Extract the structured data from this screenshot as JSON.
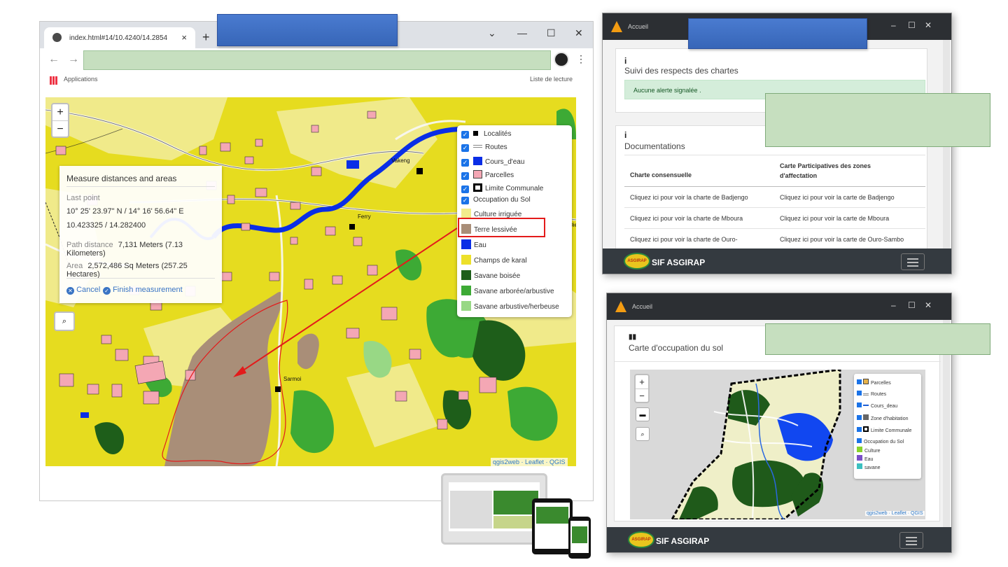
{
  "browser": {
    "tab_title": "index.html#14/10.4240/14.2854",
    "tab_close": "×",
    "new_tab": "+",
    "minimize": "⌄",
    "min2": "—",
    "max": "☐",
    "close": "✕",
    "back": "←",
    "forward": "→",
    "bookmarks_apps": "Applications",
    "bookmarks_list": "Liste de lecture"
  },
  "map": {
    "zoom_in": "+",
    "zoom_out": "−",
    "measure": {
      "title": "Measure distances and areas",
      "last_point_label": "Last point",
      "coords_dms": "10° 25' 23.97\" N / 14° 16' 56.64\" E",
      "coords_dec": "10.423325 / 14.282400",
      "path_label": "Path distance",
      "path_value": "7,131 Meters (7.13 Kilometers)",
      "area_label": "Area",
      "area_value": "2,572,486 Sq Meters (257.25 Hectares)",
      "cancel": "Cancel",
      "finish": "Finish measurement"
    },
    "legend": {
      "layers": [
        {
          "label": "Localités",
          "color": "#000000"
        },
        {
          "label": "Routes",
          "color": "#999999"
        },
        {
          "label": "Cours_d'eau",
          "color": "#0a2ee6"
        },
        {
          "label": "Parcelles",
          "color": "#f4a7b4"
        },
        {
          "label": "Limite Communale",
          "color": "#000000"
        },
        {
          "label": "Occupation du Sol",
          "color": ""
        }
      ],
      "classes": [
        {
          "label": "Culture irriguée",
          "color": "#f2ec8c"
        },
        {
          "label": "Terre lessivée",
          "color": "#a98e78"
        },
        {
          "label": "Eau",
          "color": "#0a2ee6"
        },
        {
          "label": "Champs de karal",
          "color": "#ede02a"
        },
        {
          "label": "Savane boisée",
          "color": "#1e5e1a"
        },
        {
          "label": "Savane arborée/arbustive",
          "color": "#3daa35"
        },
        {
          "label": "Savane arbustive/herbeuse",
          "color": "#98d885"
        }
      ]
    },
    "places": [
      "Vakeng",
      "Ferry",
      "Sarmoi",
      "Die"
    ],
    "attribution": "qgis2web · Leaflet · QGIS"
  },
  "app1": {
    "title": "Accueil",
    "alert_section_title": "Suivi des respects des chartes",
    "alert_text": "Aucune alerte signalée .",
    "docs_title": "Documentations",
    "col1": "Charte consensuelle",
    "col2": "Carte Participatives des zones d'affectation",
    "rows": [
      {
        "a": "Cliquez ici pour voir la charte de Badjengo",
        "b": "Cliquez ici pour voir la carte de Badjengo"
      },
      {
        "a": "Cliquez ici pour voir la charte de Mboura",
        "b": "Cliquez ici pour voir la carte de Mboura"
      },
      {
        "a": "Cliquez ici pour voir la charte de Ouro-",
        "b": "Cliquez ici pour voir la carte de Ouro-Sambo"
      }
    ],
    "footer_name": "SIF ASGIRAP",
    "footer_logo": "ASGIRAP"
  },
  "app2": {
    "title": "Accueil",
    "map_title": "Carte d'occupation du sol",
    "legend": [
      {
        "label": "Parcelles",
        "color": "#e8b34a"
      },
      {
        "label": "Routes",
        "color": "#999999"
      },
      {
        "label": "Cours_deau",
        "color": "#1f5fd6"
      },
      {
        "label": "Zone d'habitation",
        "color": "#666666"
      },
      {
        "label": "Limite Communale",
        "color": "#000000"
      },
      {
        "label": "Occupation du Sol",
        "color": ""
      },
      {
        "label": "Culture",
        "color": "#88d42a"
      },
      {
        "label": "Eau",
        "color": "#7b4fc7"
      },
      {
        "label": "savane",
        "color": "#3cc0c0"
      }
    ],
    "attribution": "qgis2web · Leaflet · QGIS",
    "footer_name": "SIF ASGIRAP",
    "footer_logo": "ASGIRAP"
  }
}
